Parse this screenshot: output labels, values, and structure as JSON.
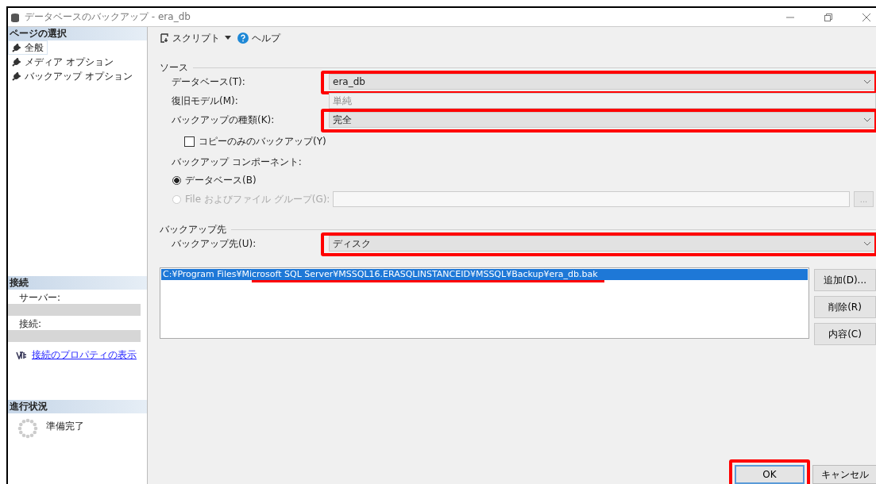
{
  "window": {
    "title": "データベースのバックアップ - era_db"
  },
  "sidebar": {
    "sections": [
      {
        "kind": "pages",
        "title": "ページの選択",
        "items": [
          {
            "label": "全般",
            "selected": true
          },
          {
            "label": "メディア オプション",
            "selected": false
          },
          {
            "label": "バックアップ オプション",
            "selected": false
          }
        ]
      },
      {
        "kind": "connection",
        "title": "接続",
        "server_label": "サーバー:",
        "connection_label": "接続:",
        "link": "接続のプロパティの表示"
      },
      {
        "kind": "progress",
        "title": "進行状況",
        "status": "準備完了"
      }
    ]
  },
  "toolbar": {
    "script": "スクリプト",
    "help": "ヘルプ"
  },
  "groups": [
    {
      "title": "ソース",
      "rows": [
        {
          "kind": "combo",
          "label": "データベース(T):",
          "value": "era_db",
          "highlighted": true
        },
        {
          "kind": "readonly",
          "label": "復旧モデル(M):",
          "value": "単純",
          "highlighted": false
        },
        {
          "kind": "combo",
          "label": "バックアップの種類(K):",
          "value": "完全",
          "highlighted": true
        },
        {
          "kind": "checkbox",
          "label": "コピーのみのバックアップ(Y)",
          "checked": false
        },
        {
          "kind": "caption",
          "label": "バックアップ コンポーネント:"
        },
        {
          "kind": "radio",
          "label": "データベース(B)",
          "selected": true,
          "disabled": false
        },
        {
          "kind": "radio",
          "label": "File およびファイル グループ(G):",
          "selected": false,
          "disabled": true,
          "browse": "..."
        }
      ]
    },
    {
      "title": "バックアップ先",
      "rows": [
        {
          "kind": "combo",
          "label": "バックアップ先(U):",
          "value": "ディスク",
          "highlighted": true
        }
      ]
    }
  ],
  "destinations": {
    "items": [
      {
        "path": "C:¥Program Files¥Microsoft SQL Server¥MSSQL16.ERASQLINSTANCEID¥MSSQL¥Backup¥era_db.bak",
        "selected": true,
        "underlined": true
      }
    ],
    "buttons": [
      "追加(D)...",
      "削除(R)",
      "内容(C)"
    ]
  },
  "footer": [
    {
      "label": "OK",
      "default": true,
      "highlighted": true
    },
    {
      "label": "キャンセル",
      "default": false,
      "highlighted": false
    }
  ]
}
